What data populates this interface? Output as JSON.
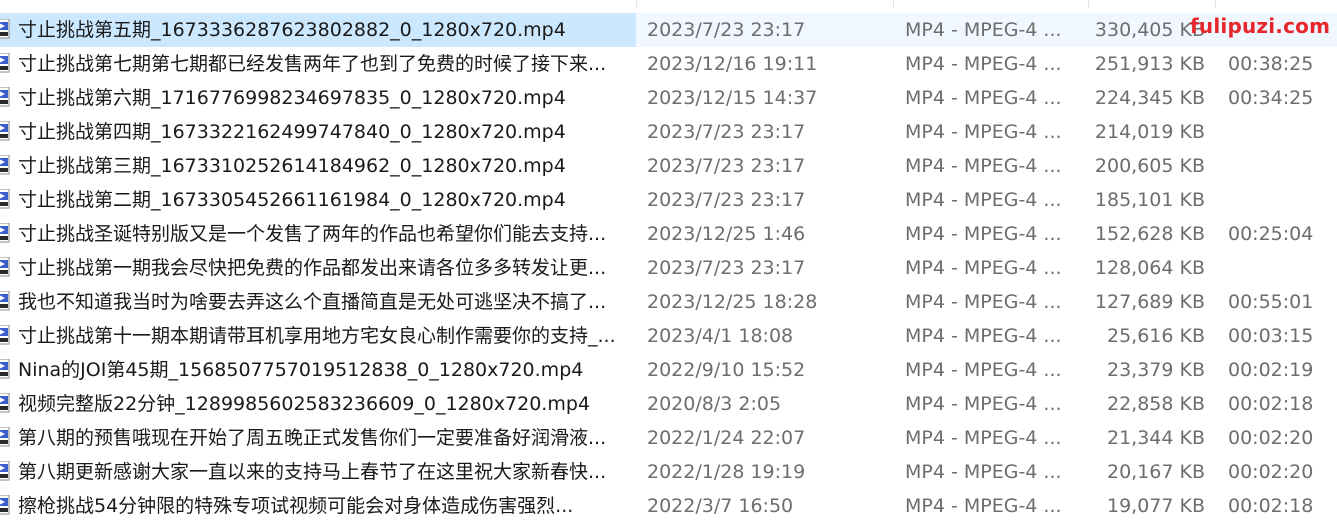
{
  "files": [
    {
      "name": "寸止挑战第五期_1673336287623802882_0_1280x720.mp4",
      "date": "2023/7/23 23:17",
      "type": "MP4 - MPEG-4 ...",
      "size": "330,405 KB",
      "length": ""
    },
    {
      "name": "寸止挑战第七期第七期都已经发售两年了也到了免费的时候了接下来...",
      "date": "2023/12/16 19:11",
      "type": "MP4 - MPEG-4 ...",
      "size": "251,913 KB",
      "length": "00:38:25"
    },
    {
      "name": "寸止挑战第六期_1716776998234697835_0_1280x720.mp4",
      "date": "2023/12/15 14:37",
      "type": "MP4 - MPEG-4 ...",
      "size": "224,345 KB",
      "length": "00:34:25"
    },
    {
      "name": "寸止挑战第四期_1673322162499747840_0_1280x720.mp4",
      "date": "2023/7/23 23:17",
      "type": "MP4 - MPEG-4 ...",
      "size": "214,019 KB",
      "length": ""
    },
    {
      "name": "寸止挑战第三期_1673310252614184962_0_1280x720.mp4",
      "date": "2023/7/23 23:17",
      "type": "MP4 - MPEG-4 ...",
      "size": "200,605 KB",
      "length": ""
    },
    {
      "name": "寸止挑战第二期_1673305452661161984_0_1280x720.mp4",
      "date": "2023/7/23 23:17",
      "type": "MP4 - MPEG-4 ...",
      "size": "185,101 KB",
      "length": ""
    },
    {
      "name": "寸止挑战圣诞特别版又是一个发售了两年的作品也希望你们能去支持...",
      "date": "2023/12/25 1:46",
      "type": "MP4 - MPEG-4 ...",
      "size": "152,628 KB",
      "length": "00:25:04"
    },
    {
      "name": "寸止挑战第一期我会尽快把免费的作品都发出来请各位多多转发让更...",
      "date": "2023/7/23 23:17",
      "type": "MP4 - MPEG-4 ...",
      "size": "128,064 KB",
      "length": ""
    },
    {
      "name": "我也不知道我当时为啥要去弄这么个直播简直是无处可逃坚决不搞了...",
      "date": "2023/12/25 18:28",
      "type": "MP4 - MPEG-4 ...",
      "size": "127,689 KB",
      "length": "00:55:01"
    },
    {
      "name": "寸止挑战第十一期本期请带耳机享用地方宅女良心制作需要你的支持_...",
      "date": "2023/4/1 18:08",
      "type": "MP4 - MPEG-4 ...",
      "size": "25,616 KB",
      "length": "00:03:15"
    },
    {
      "name": "Nina的JOI第45期_1568507757019512838_0_1280x720.mp4",
      "date": "2022/9/10 15:52",
      "type": "MP4 - MPEG-4 ...",
      "size": "23,379 KB",
      "length": "00:02:19"
    },
    {
      "name": "视频完整版22分钟_1289985602583236609_0_1280x720.mp4",
      "date": "2020/8/3 2:05",
      "type": "MP4 - MPEG-4 ...",
      "size": "22,858 KB",
      "length": "00:02:18"
    },
    {
      "name": "第八期的预售哦现在开始了周五晚正式发售你们一定要准备好润滑液...",
      "date": "2022/1/24 22:07",
      "type": "MP4 - MPEG-4 ...",
      "size": "21,344 KB",
      "length": "00:02:20"
    },
    {
      "name": "第八期更新感谢大家一直以来的支持马上春节了在这里祝大家新春快...",
      "date": "2022/1/28 19:19",
      "type": "MP4 - MPEG-4 ...",
      "size": "20,167 KB",
      "length": "00:02:20"
    },
    {
      "name": "擦枪挑战54分钟限的特殊专项试视频可能会对身体造成伤害强烈...",
      "date": "2022/3/7 16:50",
      "type": "MP4 - MPEG-4 ...",
      "size": "19,077 KB",
      "length": "00:02:18"
    }
  ],
  "watermark": "fulipuzi.com",
  "icon": "video-file-icon",
  "colors": {
    "selection": "#cce8ff",
    "watermark": "#e6262b",
    "secondary_text": "#6d6d6d"
  }
}
